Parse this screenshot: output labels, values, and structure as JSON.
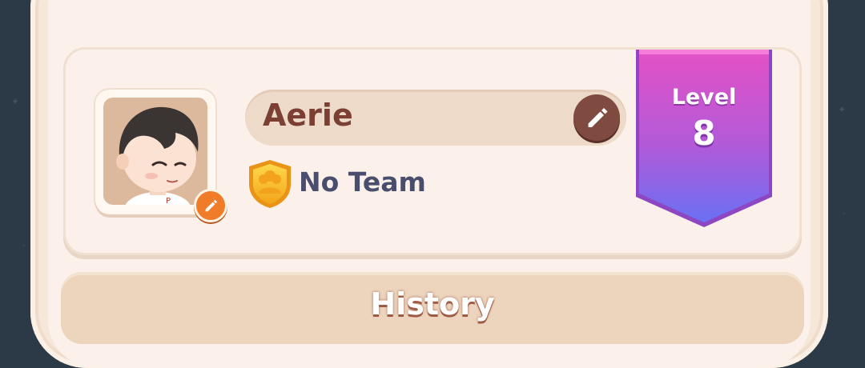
{
  "profile": {
    "player_name": "Aerie",
    "team_label": "No Team",
    "level_label": "Level",
    "level_value": "8"
  },
  "tabs": {
    "history_label": "History"
  },
  "icons": {
    "avatar_edit": "pencil-icon",
    "name_edit": "pencil-icon",
    "team": "team-shield-icon"
  },
  "colors": {
    "background": "#2c3a47",
    "panel": "#f6e7d9",
    "name_text": "#7b3f33",
    "team_text": "#4a4e6e",
    "level_gradient_top": "#e04fc8",
    "level_gradient_bottom": "#6a6cf2",
    "edit_button_orange": "#f07c2a",
    "edit_button_brown": "#7f4a40"
  }
}
